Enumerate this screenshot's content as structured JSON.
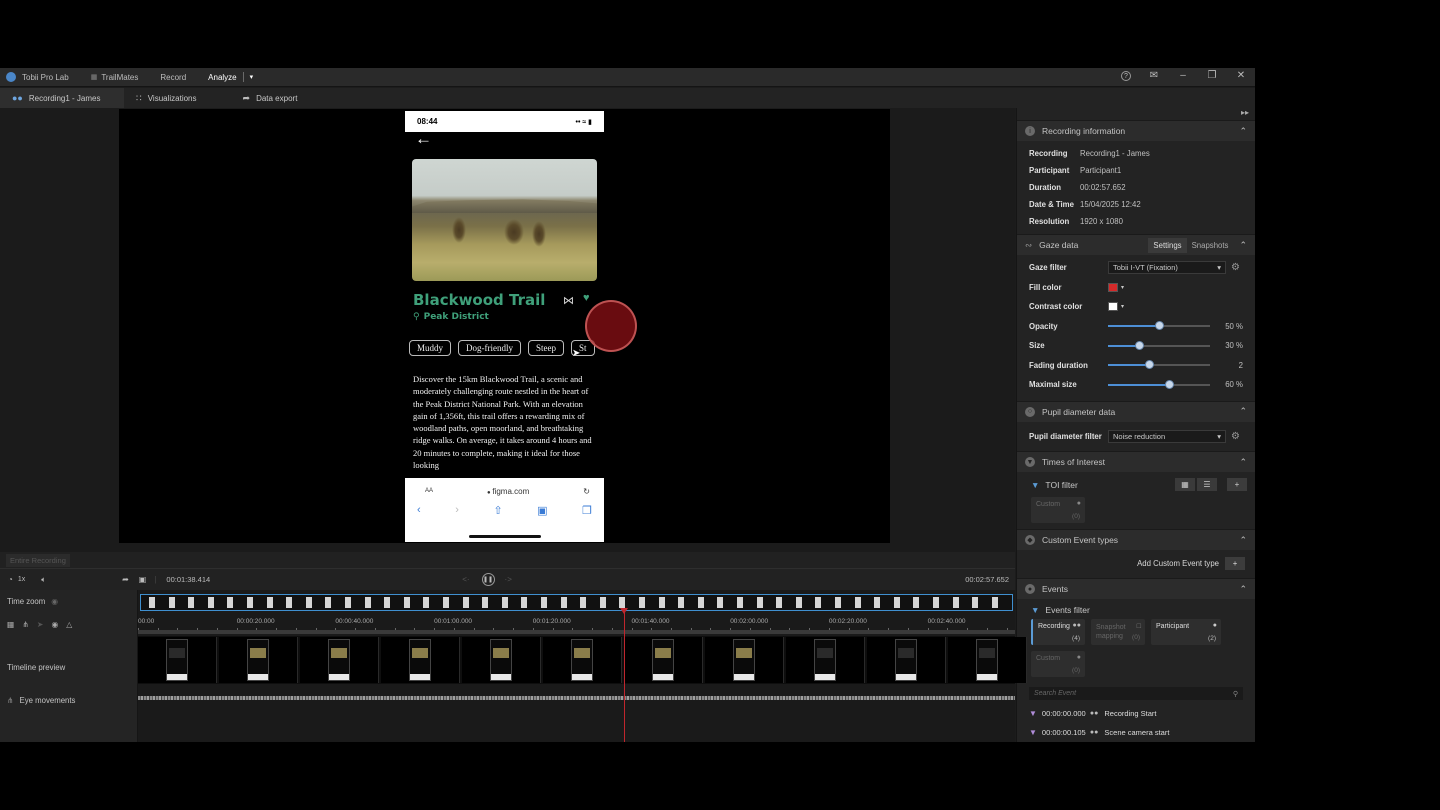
{
  "titlebar": {
    "app_name": "Tobii Pro Lab",
    "project": "TrailMates",
    "record": "Record",
    "analyze": "Analyze",
    "help_icon": "?",
    "feedback_icon": "✉",
    "minimize": "–",
    "maximize": "❐",
    "close": "✕"
  },
  "tabs": {
    "recording": "Recording1 - James",
    "visualizations": "Visualizations",
    "data_export": "Data export"
  },
  "phone": {
    "time": "08:44",
    "status_icons": "•• ≈ ▮",
    "title": "Blackwood Trail",
    "location": "Peak District",
    "chips": [
      "Muddy",
      "Dog-friendly",
      "Steep",
      "St"
    ],
    "description": "Discover the 15km Blackwood Trail, a scenic and moderately challenging route nestled in the heart of the Peak District National Park. With an elevation gain of 1,356ft, this trail offers a rewarding mix of woodland paths, open moorland, and breathtaking ridge walks. On average, it takes around 4 hours and 20 minutes to complete, making it ideal for those looking",
    "browser": {
      "aa": "AA",
      "url": "figma.com",
      "reload": "↻"
    }
  },
  "right_panel": {
    "recording_info": {
      "header": "Recording information",
      "rows": [
        {
          "k": "Recording",
          "v": "Recording1 - James"
        },
        {
          "k": "Participant",
          "v": "Participant1"
        },
        {
          "k": "Duration",
          "v": "00:02:57.652"
        },
        {
          "k": "Date & Time",
          "v": "15/04/2025 12:42"
        },
        {
          "k": "Resolution",
          "v": "1920 x 1080"
        }
      ]
    },
    "gaze": {
      "header": "Gaze data",
      "tab_settings": "Settings",
      "tab_snapshots": "Snapshots",
      "gaze_filter_label": "Gaze filter",
      "gaze_filter_value": "Tobii I-VT (Fixation)",
      "fill_color_label": "Fill color",
      "fill_color": "#d42a2a",
      "contrast_color_label": "Contrast color",
      "contrast_color": "#ffffff",
      "sliders": [
        {
          "label": "Opacity",
          "value": "50 %",
          "fraction": 0.5
        },
        {
          "label": "Size",
          "value": "30 %",
          "fraction": 0.3
        },
        {
          "label": "Fading duration",
          "value": "2",
          "fraction": 0.4
        },
        {
          "label": "Maximal size",
          "value": "60 %",
          "fraction": 0.6
        }
      ]
    },
    "pupil": {
      "header": "Pupil diameter data",
      "filter_label": "Pupil diameter filter",
      "filter_value": "Noise reduction"
    },
    "toi": {
      "header": "Times of Interest",
      "filter_label": "TOI filter",
      "card_label": "Custom",
      "card_count": "(0)"
    },
    "custom_events": {
      "header": "Custom Event types",
      "add_label": "Add Custom Event type"
    },
    "events": {
      "header": "Events",
      "filter_label": "Events filter",
      "cards": [
        {
          "label": "Recording",
          "count": "(4)"
        },
        {
          "label": "Snapshot mapping",
          "count": "(0)"
        },
        {
          "label": "Participant",
          "count": "(2)"
        },
        {
          "label": "Custom",
          "count": "(0)"
        }
      ],
      "search_placeholder": "Search Event",
      "rows": [
        {
          "time": "00:00:00.000",
          "name": "Recording Start"
        },
        {
          "time": "00:00:00.105",
          "name": "Scene camera start"
        }
      ]
    }
  },
  "timeline": {
    "scope": "Entire Recording",
    "speed": "1x",
    "current_time": "00:01:38.414",
    "total_time": "00:02:57.652",
    "time_zoom": "Time zoom",
    "timeline_preview": "Timeline preview",
    "eye_movements": "Eye movements",
    "ticks": [
      "00:00",
      "00:00:20.000",
      "00:00:40.000",
      "00:01:00.000",
      "00:01:20.000",
      "00:01:40.000",
      "00:02:00.000",
      "00:02:20.000",
      "00:02:40.000"
    ],
    "playhead_fraction": 0.554
  }
}
